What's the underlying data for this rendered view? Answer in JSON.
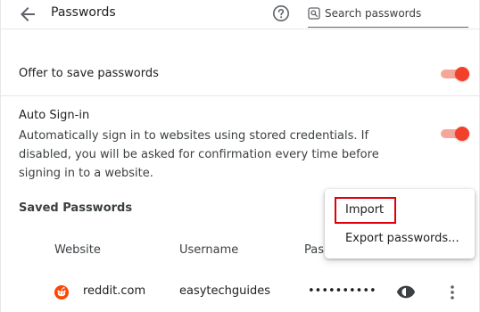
{
  "header": {
    "title": "Passwords",
    "back_icon": "arrow-left",
    "help_icon": "question-circle",
    "search": {
      "icon": "search-box",
      "placeholder": "Search passwords",
      "value": ""
    }
  },
  "settings": {
    "offer_save": {
      "label": "Offer to save passwords",
      "enabled": true
    },
    "auto_signin": {
      "label": "Auto Sign-in",
      "description": "Automatically sign in to websites using stored credentials. If disabled, you will be asked for confirmation every time before signing in to a website.",
      "enabled": true
    }
  },
  "saved_passwords": {
    "title": "Saved Passwords",
    "columns": {
      "website": "Website",
      "username": "Username",
      "password": "Pas"
    },
    "rows": [
      {
        "website": "reddit.com",
        "username": "easytechguides",
        "password": "••••••••••",
        "icon": "reddit-logo"
      }
    ]
  },
  "menu": {
    "items": [
      {
        "label": "Import",
        "highlighted": true
      },
      {
        "label": "Export passwords..."
      }
    ]
  },
  "colors": {
    "accent": "#f2402b",
    "accent_track": "#f5a899",
    "highlight_border": "#e0000d",
    "reddit": "#ff4500"
  }
}
